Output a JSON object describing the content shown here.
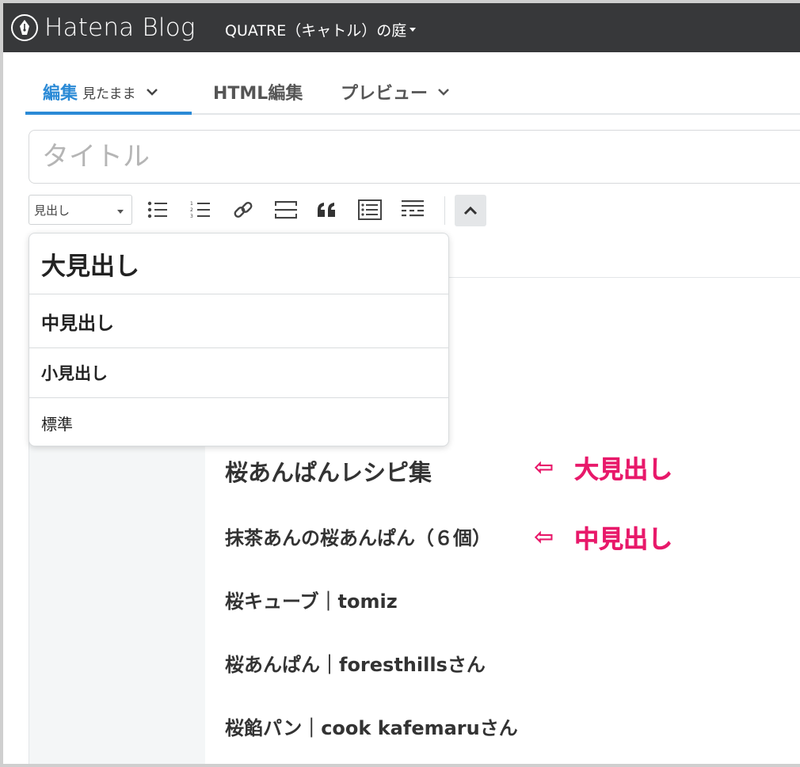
{
  "topbar": {
    "logo_text": "Hatena Blog",
    "blog_name": "QUATRE（キャトル）の庭"
  },
  "tabs": [
    {
      "label": "編集",
      "sub": "見たまま"
    },
    {
      "label": "HTML編集"
    },
    {
      "label": "プレビュー"
    }
  ],
  "title_input": {
    "placeholder": "タイトル"
  },
  "toolbar": {
    "heading_select": "見出し",
    "tools": [
      "bullet-list-icon",
      "numbered-list-icon",
      "link-icon",
      "horizontal-rule-icon",
      "blockquote-icon",
      "table-of-contents-icon",
      "read-more-icon",
      "collapse-icon"
    ]
  },
  "dropdown": {
    "items": [
      "大見出し",
      "中見出し",
      "小見出し",
      "標準"
    ]
  },
  "content": {
    "lines": [
      "桜あんぱんレシピ集",
      "抹茶あんの桜あんぱん（６個）",
      "桜キューブ｜tomiz",
      "桜あんぱん｜foresthillsさん",
      "桜餡パン｜cook kafemaruさん"
    ]
  },
  "annotations": [
    {
      "arrow": "⇦",
      "label": "大見出し"
    },
    {
      "arrow": "⇦",
      "label": "中見出し"
    }
  ],
  "colors": {
    "topbar": "#37383a",
    "accent": "#2b8ad6",
    "annotation": "#e8196a"
  }
}
